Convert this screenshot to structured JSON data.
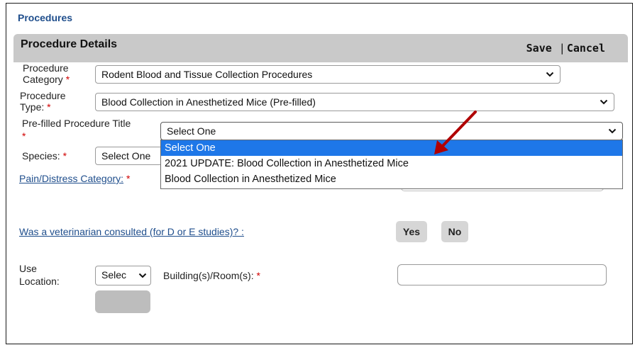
{
  "page": {
    "title": "Procedures"
  },
  "panel": {
    "title": "Procedure Details",
    "save_label": "Save",
    "cancel_label": "Cancel",
    "separator": "|"
  },
  "fields": {
    "procedure_category": {
      "label_line1": "Procedure",
      "label_line2": "Category",
      "required_mark": "*",
      "value": "Rodent Blood and Tissue Collection Procedures"
    },
    "procedure_type": {
      "label_line1": "Procedure",
      "label_line2": "Type:",
      "required_mark": "*",
      "value": "Blood Collection in Anesthetized Mice (Pre-filled)"
    },
    "prefilled_title": {
      "label": "Pre-filled Procedure Title",
      "required_mark": "*",
      "value": "Select One",
      "options": [
        "Select One",
        "2021 UPDATE: Blood Collection in Anesthetized Mice",
        "Blood Collection in Anesthetized Mice"
      ]
    },
    "species": {
      "label": "Species:",
      "required_mark": "*",
      "value": "Select One"
    },
    "pain_distress": {
      "label": "Pain/Distress Category:",
      "required_mark": "*"
    },
    "vet_consulted": {
      "label": "Was a veterinarian consulted (for D or E studies)? :",
      "yes_label": "Yes",
      "no_label": "No"
    },
    "use_location": {
      "label_line1": "Use",
      "label_line2": "Location:",
      "value": "Selec"
    },
    "building_room": {
      "label": "Building(s)/Room(s):",
      "required_mark": "*",
      "value": ""
    }
  },
  "colors": {
    "accent_link": "#1f4e8c",
    "required": "#d00000",
    "selection": "#1e77e8",
    "arrow": "#b00000"
  },
  "icons": {
    "dropdown": "chevron-down-icon",
    "annotation": "red-arrow-icon"
  }
}
